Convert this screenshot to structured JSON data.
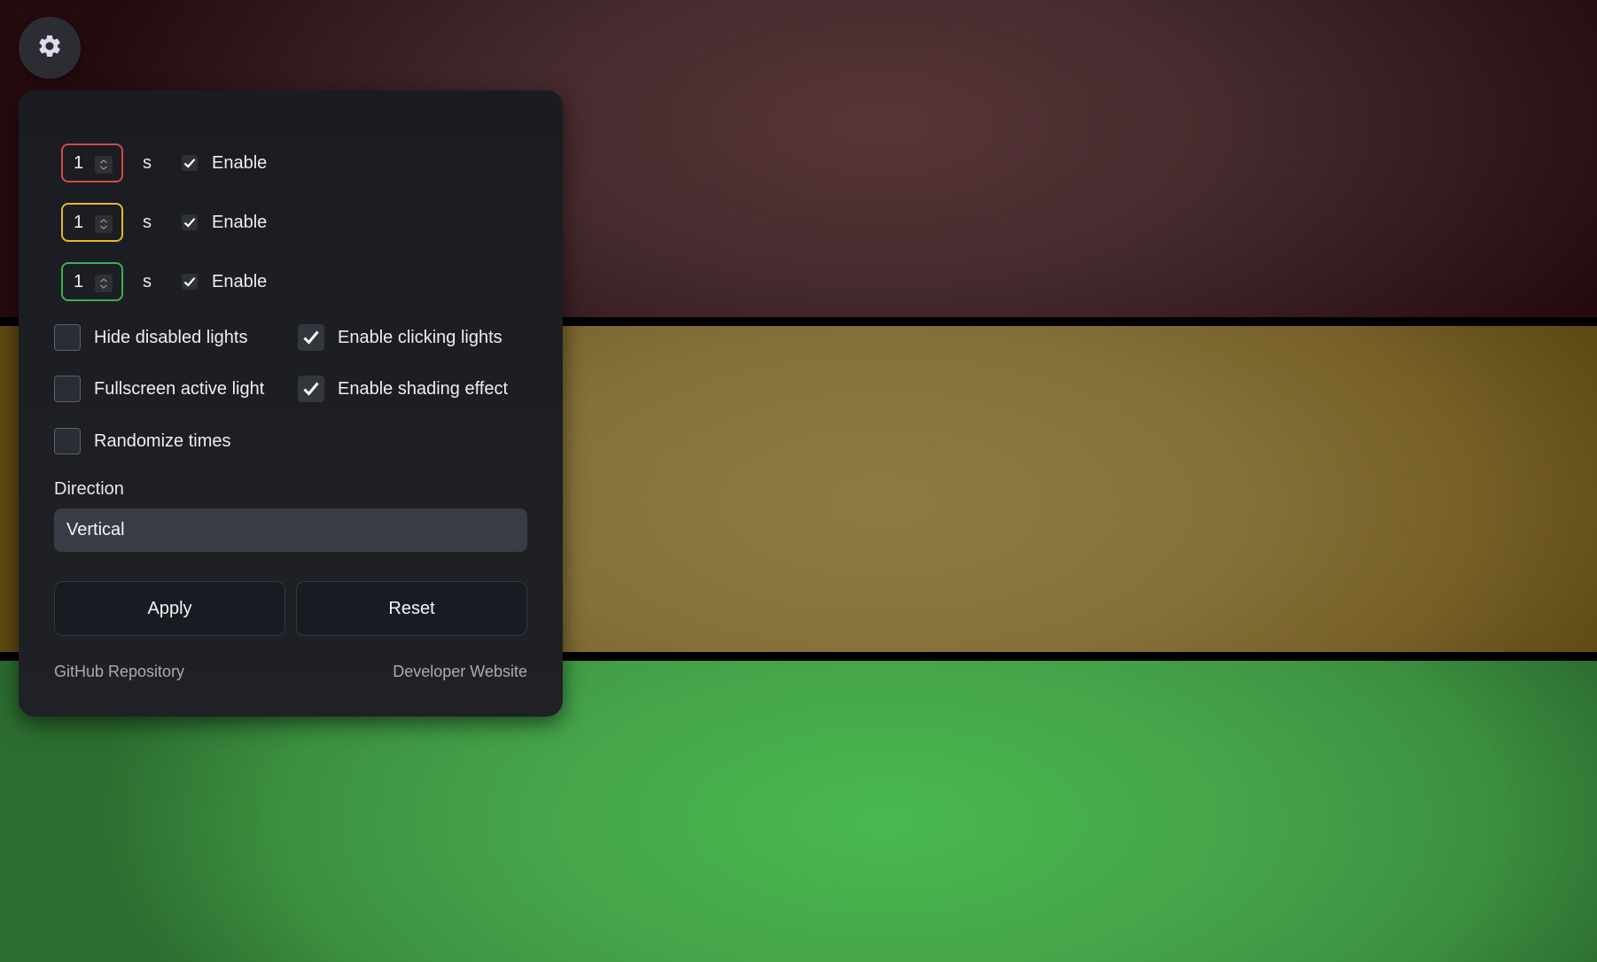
{
  "settings_icon": "gear-icon",
  "colors": {
    "red_border": "#d24a4a",
    "yellow_border": "#e8b62c",
    "green_border": "#3fae4c"
  },
  "lights": [
    {
      "name": "red",
      "duration": "1",
      "unit": "s",
      "enable_label": "Enable",
      "enabled": true
    },
    {
      "name": "yellow",
      "duration": "1",
      "unit": "s",
      "enable_label": "Enable",
      "enabled": true
    },
    {
      "name": "green",
      "duration": "1",
      "unit": "s",
      "enable_label": "Enable",
      "enabled": true
    }
  ],
  "options": {
    "hide_disabled": {
      "label": "Hide disabled lights",
      "checked": false
    },
    "enable_clicking": {
      "label": "Enable clicking lights",
      "checked": true
    },
    "fullscreen_active": {
      "label": "Fullscreen active light",
      "checked": false
    },
    "enable_shading": {
      "label": "Enable shading effect",
      "checked": true
    },
    "randomize_times": {
      "label": "Randomize times",
      "checked": false
    }
  },
  "direction": {
    "label": "Direction",
    "selected": "Vertical"
  },
  "buttons": {
    "apply": "Apply",
    "reset": "Reset"
  },
  "footer": {
    "github": "GitHub Repository",
    "developer": "Developer Website"
  }
}
